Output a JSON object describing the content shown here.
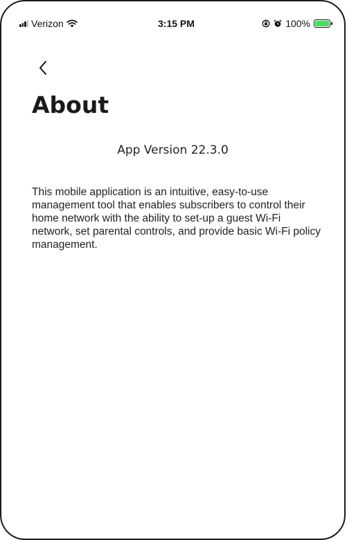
{
  "status_bar": {
    "carrier": "Verizon",
    "time": "3:15 PM",
    "battery": "100%",
    "battery_level": 1.0,
    "icons": [
      "signal-bars-icon",
      "wifi-icon",
      "screen-rotation-lock-icon",
      "alarm-icon",
      "battery-charging-icon"
    ]
  },
  "header": {
    "back_icon": "chevron-left-icon",
    "title": "About"
  },
  "content": {
    "version": "App Version 22.3.0",
    "description": "This mobile application is an intuitive, easy-to-use management tool that enables subscribers to control their home network with the ability to set-up a guest Wi-Fi network, set parental controls, and provide basic Wi-Fi policy management."
  },
  "colors": {
    "battery_fill": "#4cd964",
    "text": "#222222",
    "background": "#ffffff"
  }
}
